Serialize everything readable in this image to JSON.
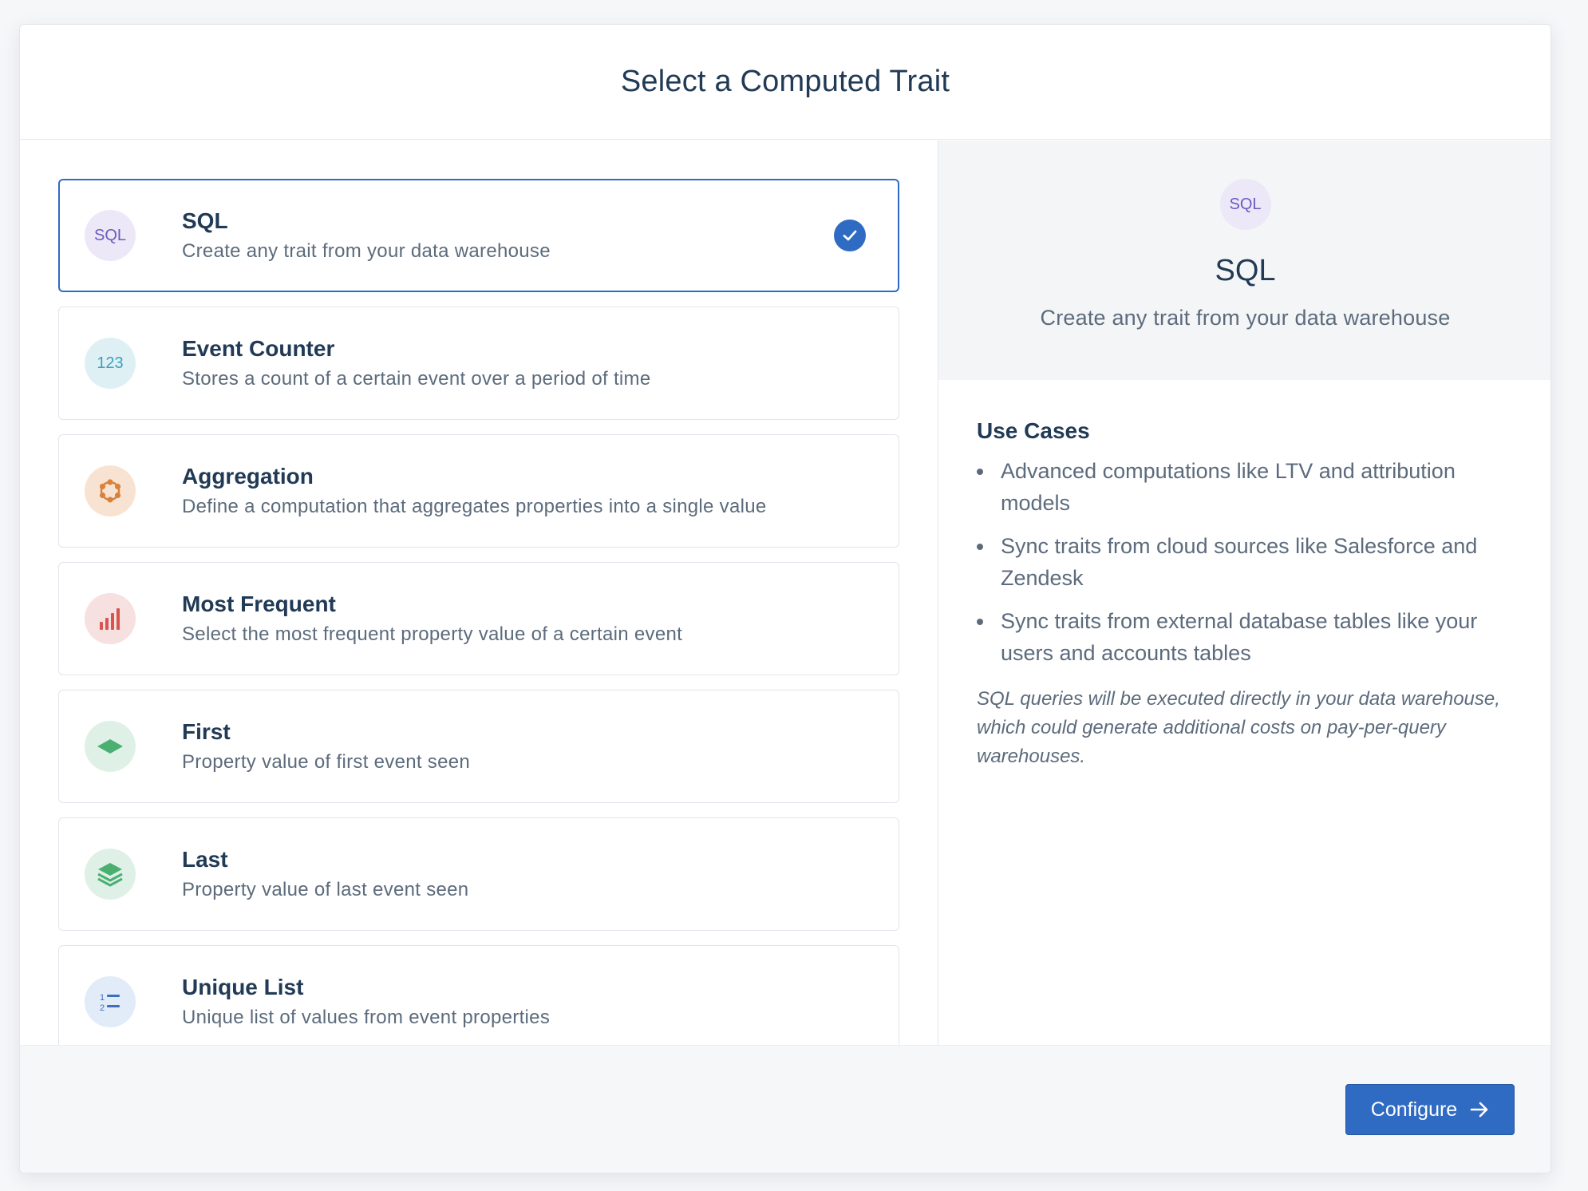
{
  "modal": {
    "title": "Select a Computed Trait"
  },
  "traits": [
    {
      "title": "SQL",
      "description": "Create any trait from your data warehouse",
      "icon": "sql-icon",
      "icon_text": "SQL",
      "icon_bg": "#ece8f8",
      "icon_color": "#6b5bbf",
      "selected": true
    },
    {
      "title": "Event Counter",
      "description": "Stores a count of a certain event over a period of time",
      "icon": "counter-icon",
      "icon_text": "123",
      "icon_bg": "#dff0f4",
      "icon_color": "#3aa0bd",
      "selected": false
    },
    {
      "title": "Aggregation",
      "description": "Define a computation that aggregates properties into a single value",
      "icon": "aggregation-icon",
      "icon_bg": "#f8e3d3",
      "icon_color": "#d9823c",
      "selected": false
    },
    {
      "title": "Most Frequent",
      "description": "Select the most frequent property value of a certain event",
      "icon": "bar-chart-icon",
      "icon_bg": "#f7e0e0",
      "icon_color": "#d9534f",
      "selected": false
    },
    {
      "title": "First",
      "description": "Property value of first event seen",
      "icon": "diamond-icon",
      "icon_bg": "#dff1e6",
      "icon_color": "#4caf72",
      "selected": false
    },
    {
      "title": "Last",
      "description": "Property value of last event seen",
      "icon": "layers-icon",
      "icon_bg": "#dff1e6",
      "icon_color": "#4caf72",
      "selected": false
    },
    {
      "title": "Unique List",
      "description": "Unique list of values from event properties",
      "icon": "numbered-list-icon",
      "icon_bg": "#e2ebf8",
      "icon_color": "#3b6fc0",
      "selected": false
    }
  ],
  "detail": {
    "icon_text": "SQL",
    "title": "SQL",
    "description": "Create any trait from your data warehouse",
    "use_cases_heading": "Use Cases",
    "use_cases": [
      "Advanced computations like LTV and attribution models",
      "Sync traits from cloud sources like Salesforce and Zendesk",
      "Sync traits from external database tables like your users and accounts tables"
    ],
    "note": "SQL queries will be executed directly in your data warehouse, which could generate additional costs on pay-per-query warehouses."
  },
  "footer": {
    "configure_label": "Configure"
  },
  "colors": {
    "accent": "#2f6bc3",
    "text_primary": "#213a55",
    "text_secondary": "#5c6b7c"
  }
}
